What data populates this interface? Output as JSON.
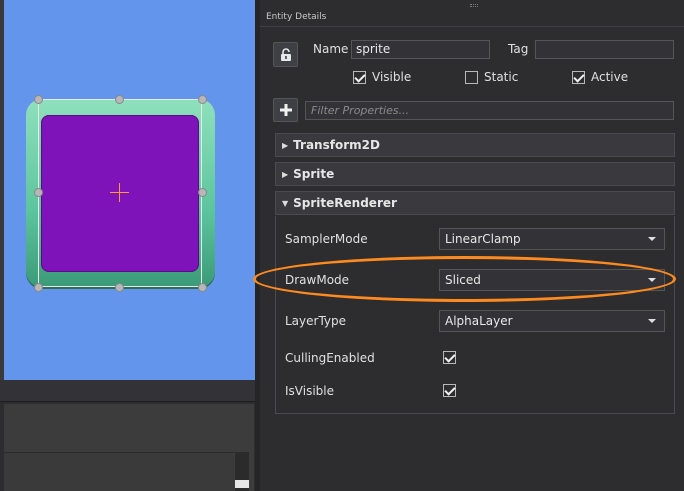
{
  "panel": {
    "title": "Entity Details"
  },
  "entity": {
    "name_label": "Name",
    "name_value": "sprite",
    "tag_label": "Tag",
    "tag_value": "",
    "visible_label": "Visible",
    "visible_checked": true,
    "static_label": "Static",
    "static_checked": false,
    "active_label": "Active",
    "active_checked": true
  },
  "filter": {
    "placeholder": "Filter Properties..."
  },
  "components": [
    {
      "name": "Transform2D",
      "expanded": false
    },
    {
      "name": "Sprite",
      "expanded": false
    },
    {
      "name": "SpriteRenderer",
      "expanded": true
    }
  ],
  "sprite_renderer": {
    "sampler_mode_label": "SamplerMode",
    "sampler_mode_value": "LinearClamp",
    "draw_mode_label": "DrawMode",
    "draw_mode_value": "Sliced",
    "layer_type_label": "LayerType",
    "layer_type_value": "AlphaLayer",
    "culling_label": "CullingEnabled",
    "culling_checked": true,
    "is_visible_label": "IsVisible",
    "is_visible_checked": true
  },
  "colors": {
    "viewport_bg": "#6495ed",
    "sprite_frame": "#5cc49d",
    "sprite_inner": "#7d13b8",
    "highlight": "#ff8a1f",
    "crosshair": "#ff9a2e"
  },
  "icons": {
    "lock": "lock-icon",
    "add": "plus-icon",
    "expand": "triangle-right-icon",
    "collapse": "triangle-down-icon",
    "dropdown": "chevron-down-icon"
  }
}
